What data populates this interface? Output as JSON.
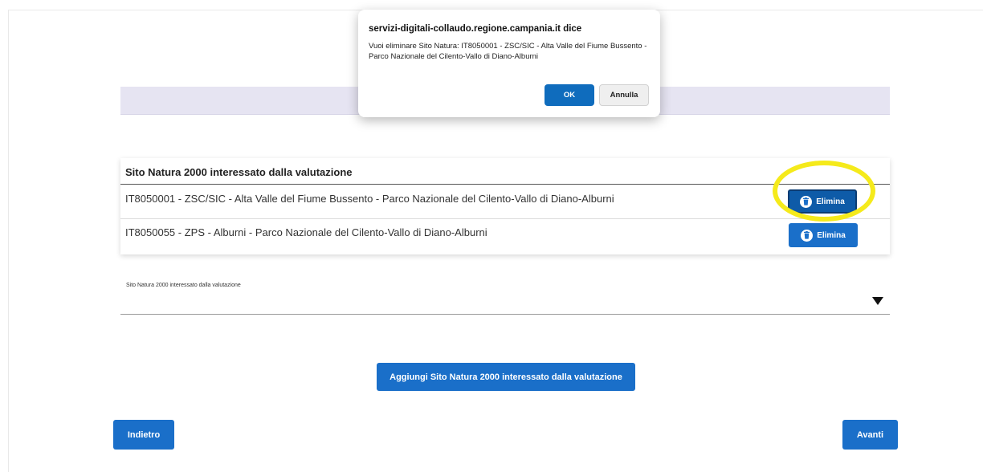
{
  "dialog": {
    "title": "servizi-digitali-collaudo.regione.campania.it dice",
    "message": "Vuoi eliminare Sito Natura: IT8050001 - ZSC/SIC - Alta Valle del Fiume Bussento - Parco Nazionale del Cilento-Vallo di Diano-Alburni",
    "ok_label": "OK",
    "cancel_label": "Annulla"
  },
  "sites_table": {
    "title": "Sito Natura 2000 interessato dalla valutazione",
    "rows": [
      {
        "text": "IT8050001 - ZSC/SIC - Alta Valle del Fiume Bussento - Parco Nazionale del Cilento-Vallo di Diano-Alburni",
        "delete_label": "Elimina",
        "delete_icon": "trash-icon"
      },
      {
        "text": "IT8050055 - ZPS - Alburni - Parco Nazionale del Cilento-Vallo di Diano-Alburni",
        "delete_label": "Elimina",
        "delete_icon": "trash-icon"
      }
    ]
  },
  "site_select": {
    "label": "Sito Natura 2000 interessato dalla valutazione",
    "value": "",
    "arrow_icon": "triangle-down-icon"
  },
  "actions": {
    "add_label": "Aggiungi Sito Natura 2000 interessato dalla valutazione",
    "back_label": "Indietro",
    "next_label": "Avanti"
  },
  "colors": {
    "primary": "#1a6fc9",
    "highlight": "#f5ea1b",
    "band": "#e6e4f2"
  }
}
